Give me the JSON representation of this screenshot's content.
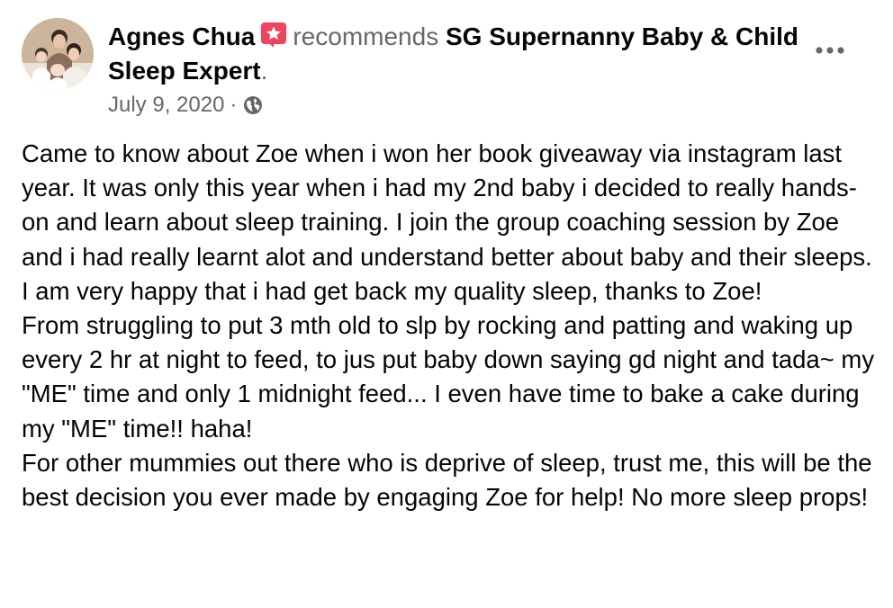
{
  "post": {
    "author": "Agnes Chua",
    "action": "recommends",
    "page_name": "SG Supernanny Baby & Child Sleep Expert",
    "period": ".",
    "date": "July 9, 2020",
    "separator": "·",
    "audience_icon": "globe-icon",
    "recommend_icon": "recommend-star-icon",
    "more_icon": "more-options-icon",
    "colors": {
      "text": "#050505",
      "secondary": "#65676b",
      "recommend_badge": "#f3425f"
    },
    "paragraphs": [
      "Came to know about Zoe when i won her book giveaway via instagram last year. It was only this year when i had my 2nd baby i decided to really hands-on and learn about sleep training. I join the group coaching session by Zoe and i had really learnt alot and understand better about baby and their sleeps. I am very happy that i had get back my quality sleep, thanks to Zoe!",
      "From struggling to put 3 mth old to slp by rocking and patting and waking up every 2 hr at night to feed, to jus put baby down saying gd night and tada~ my \"ME\" time and only 1 midnight feed... I even have time to bake a cake during my \"ME\" time!! haha!",
      "For other mummies out there who is deprive of sleep, trust me, this will be the best decision you ever made by engaging Zoe for help! No more sleep props!"
    ]
  }
}
